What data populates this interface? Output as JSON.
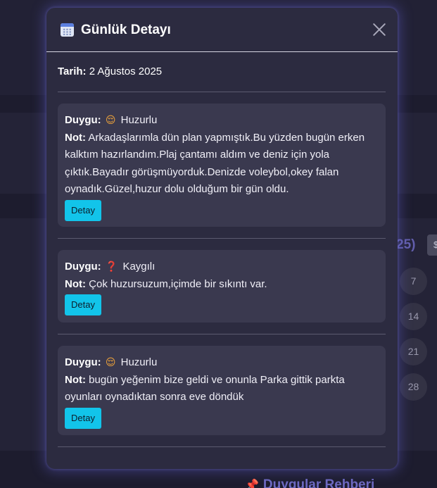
{
  "background": {
    "year_fragment": "25)",
    "button_fragment": "$",
    "days": [
      "7",
      "14",
      "21",
      "28"
    ],
    "footer_title": "Duygular Rehberi",
    "footer_icon": "pushpin-icon"
  },
  "modal": {
    "icon": "calendar-icon",
    "title": "Günlük Detayı",
    "close_icon": "close-icon",
    "date_label": "Tarih:",
    "date_value": "2 Ağustos 2025",
    "entries": [
      {
        "mood_label": "Duygu:",
        "mood_emoji": "😌",
        "mood_icon": "relieved-face-icon",
        "mood": "Huzurlu",
        "note_label": "Not:",
        "note": "Arkadaşlarımla dün plan yapmıştık.Bu yüzden bugün erken kalktım hazırlandım.Plaj çantamı aldım ve deniz için yola çıktık.Bayadır görüşmüyorduk.Denizde voleybol,okey falan oynadık.Güzel,huzur dolu olduğum bir gün oldu.",
        "button": "Detay"
      },
      {
        "mood_label": "Duygu:",
        "mood_emoji": "❓",
        "mood_icon": "question-mark-icon",
        "mood": "Kaygılı",
        "note_label": "Not:",
        "note": "Çok huzursuzum,içimde bir sıkıntı var.",
        "button": "Detay"
      },
      {
        "mood_label": "Duygu:",
        "mood_emoji": "😌",
        "mood_icon": "relieved-face-icon",
        "mood": "Huzurlu",
        "note_label": "Not:",
        "note": "bugün yeğenim bize geldi ve onunla Parka gittik parkta oyunları oynadıktan sonra eve döndük",
        "button": "Detay"
      }
    ]
  },
  "colors": {
    "accent_button": "#12c4ea",
    "modal_bg": "#2c2b40",
    "card_bg": "#3a394f",
    "highlight_text": "#6e6ac2"
  }
}
